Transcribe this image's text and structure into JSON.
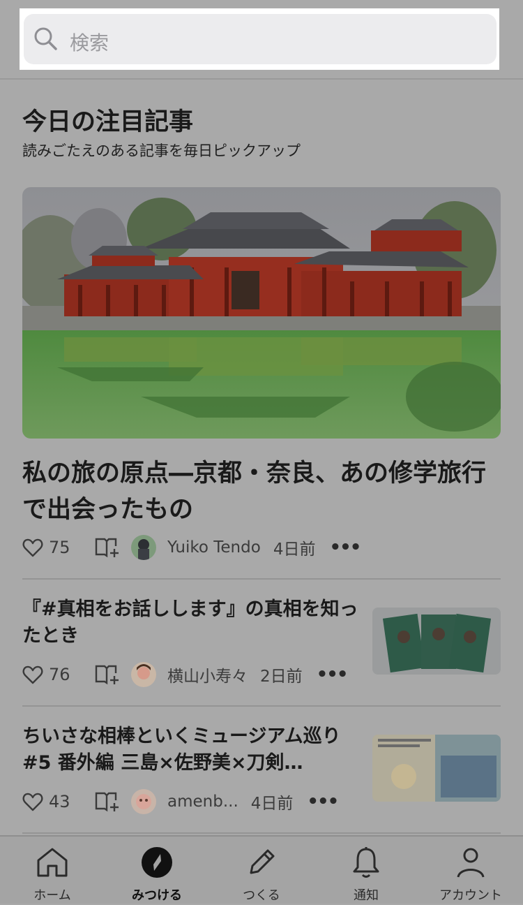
{
  "search": {
    "placeholder": "検索"
  },
  "section": {
    "title": "今日の注目記事",
    "subtitle": "読みごたえのある記事を毎日ピックアップ"
  },
  "featured": {
    "title": "私の旅の原点―京都・奈良、あの修学旅行で出会ったもの",
    "likes": "75",
    "author": "Yuiko Tendo",
    "time": "4日前",
    "more": "•••"
  },
  "articles": [
    {
      "title": "『#真相をお話しします』の真相を知ったとき",
      "likes": "76",
      "author": "横山小寿々",
      "time": "2日前",
      "more": "•••"
    },
    {
      "title": "ちいさな相棒といくミュージアム巡り#5 番外編 三島×佐野美×刀剣…",
      "likes": "43",
      "author": "amenb...",
      "time": "4日前",
      "more": "•••"
    }
  ],
  "nav": [
    {
      "label": "ホーム",
      "icon": "home-icon"
    },
    {
      "label": "みつける",
      "icon": "compass-icon"
    },
    {
      "label": "つくる",
      "icon": "pencil-icon"
    },
    {
      "label": "通知",
      "icon": "bell-icon"
    },
    {
      "label": "アカウント",
      "icon": "person-icon"
    }
  ],
  "colors": {
    "overlay": "#a9a9a9",
    "accent": "#1a1a1a"
  }
}
